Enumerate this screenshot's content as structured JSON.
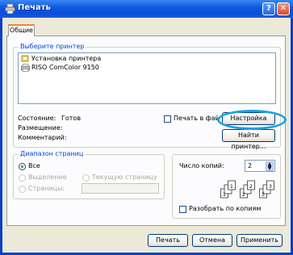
{
  "window": {
    "title": "Печать",
    "help_glyph": "?",
    "close_glyph": "✕"
  },
  "tabs": [
    {
      "label": "Общие",
      "selected": true
    }
  ],
  "printer_group": {
    "legend": "Выберите принтер",
    "items": [
      {
        "label": "Установка принтера",
        "icon": "add-printer-icon"
      },
      {
        "label": "RISO ComColor 9150",
        "icon": "printer-icon",
        "selected": true
      }
    ],
    "status_label": "Состояние:",
    "status_value": "Готов",
    "location_label": "Размещение:",
    "comment_label": "Комментарий:",
    "print_to_file_label": "Печать в файл",
    "print_to_file_checked": false,
    "settings_button": "Настройка",
    "find_printer_button": "Найти принтер..."
  },
  "range_group": {
    "legend": "Диапазон страниц",
    "all_label": "Все",
    "selection_label": "Выделение",
    "current_page_label": "Текущую страницу",
    "pages_label": "Страницы:",
    "selected": "all"
  },
  "copies": {
    "label": "Число копий:",
    "value": "2",
    "collate_label": "Разобрать по копиям",
    "collate_checked": false
  },
  "footer": {
    "print_button": "Печать",
    "cancel_button": "Отмена",
    "apply_button": "Применить"
  },
  "colors": {
    "title_bar": "#0b4fd4",
    "group_legend": "#0046d5",
    "highlight": "#1ea0e6"
  }
}
